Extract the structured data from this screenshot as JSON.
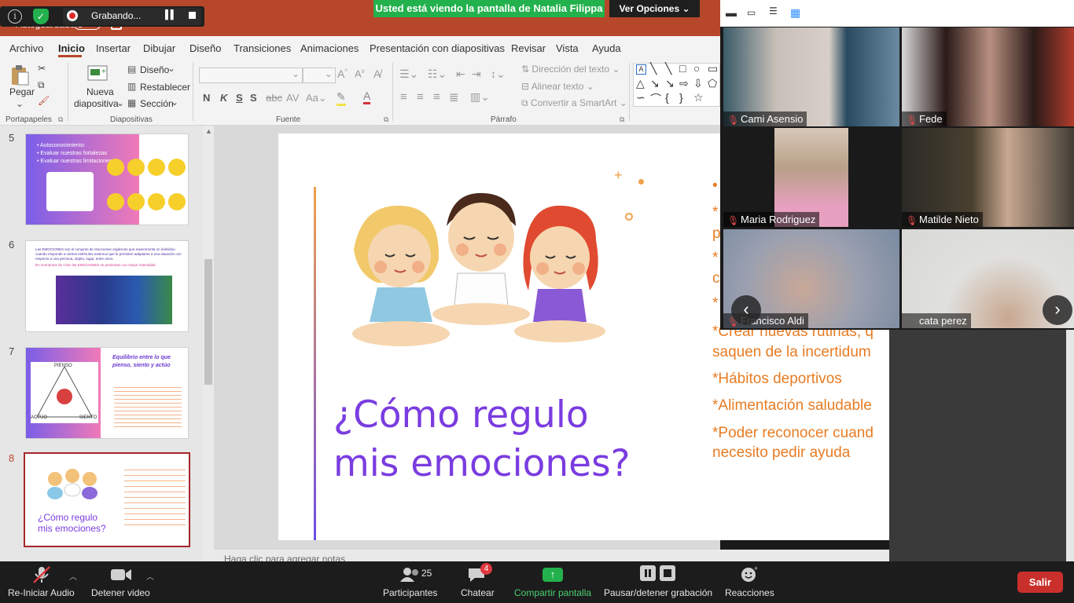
{
  "zoom_top": {
    "recording_label": "Grabando...",
    "viewing_banner": "Usted está viendo la pantalla de Natalia Filippa",
    "view_options": "Ver Opciones"
  },
  "ppt": {
    "autosave_label": "Autoguardado",
    "tabs": [
      "Archivo",
      "Inicio",
      "Insertar",
      "Dibujar",
      "Diseño",
      "Transiciones",
      "Animaciones",
      "Presentación con diapositivas",
      "Revisar",
      "Vista",
      "Ayuda"
    ],
    "ribbon": {
      "paste": "Pegar",
      "new_slide_1": "Nueva",
      "new_slide_2": "diapositiva",
      "layout": "Diseño",
      "reset": "Restablecer",
      "section": "Sección",
      "text_direction": "Dirección del texto",
      "align_text": "Alinear texto",
      "convert_smartart": "Convertir a SmartArt",
      "groups": {
        "clipboard": "Portapapeles",
        "slides": "Diapositivas",
        "font": "Fuente",
        "paragraph": "Párrafo"
      },
      "font_format": [
        "N",
        "K",
        "S",
        "S"
      ]
    },
    "thumbnails": [
      {
        "number": "5",
        "lines": [
          "• Autoconocimiento:",
          "• Evaluar nuestras fortalezas",
          "• Evaluar nuestras limitaciones"
        ]
      },
      {
        "number": "6",
        "lines": [
          "Las EMOCIONES son el conjunto de reacciones orgánicas que experimenta un individuo cuando responde a ciertos estímulos externos que le permiten adaptarse a una situación con respecto a una persona, objeto, lugar, entre otros.",
          "En momentos de crisis las EMOCIONES se presentan con mayor intensidad"
        ]
      },
      {
        "number": "7",
        "title": "Equilibrio entre lo que pienso, siento y actúo",
        "labels": [
          "PIENSO",
          "ACTÚO",
          "SIENTO"
        ]
      },
      {
        "number": "8",
        "title": "¿Cómo regulo mis emociones?"
      }
    ],
    "slide": {
      "title_line1": "¿Cómo regulo",
      "title_line2": "mis emociones?",
      "bullets": [
        "•",
        "*",
        "p",
        "*",
        "c",
        "*",
        "*Crear nuevas rutinas, q",
        "saquen de la incertidum",
        "*Hábitos deportivos",
        "*Alimentación saludable",
        "*Poder reconocer cuand",
        "necesito pedir ayuda"
      ]
    },
    "notes_placeholder": "Haga clic para agregar notas"
  },
  "participants": [
    {
      "name": "Cami Asensio",
      "bg": "#4a6778"
    },
    {
      "name": "Fede",
      "bg": "#3a2a28"
    },
    {
      "name": "Maria Rodriguez",
      "bg": "#b8a898"
    },
    {
      "name": "Matilde Nieto",
      "bg": "#2e2c28"
    },
    {
      "name": "Francisco Aldi",
      "bg": "#8a96a8"
    },
    {
      "name": "cata perez",
      "bg": "#d8d8d6"
    }
  ],
  "toolbar": {
    "audio": "Re-Iniciar Audio",
    "video": "Detener video",
    "participants": "Participantes",
    "participant_count": "25",
    "chat": "Chatear",
    "chat_badge": "4",
    "share": "Compartir pantalla",
    "record": "Pausar/detener grabación",
    "reactions": "Reacciones",
    "leave": "Salir"
  }
}
